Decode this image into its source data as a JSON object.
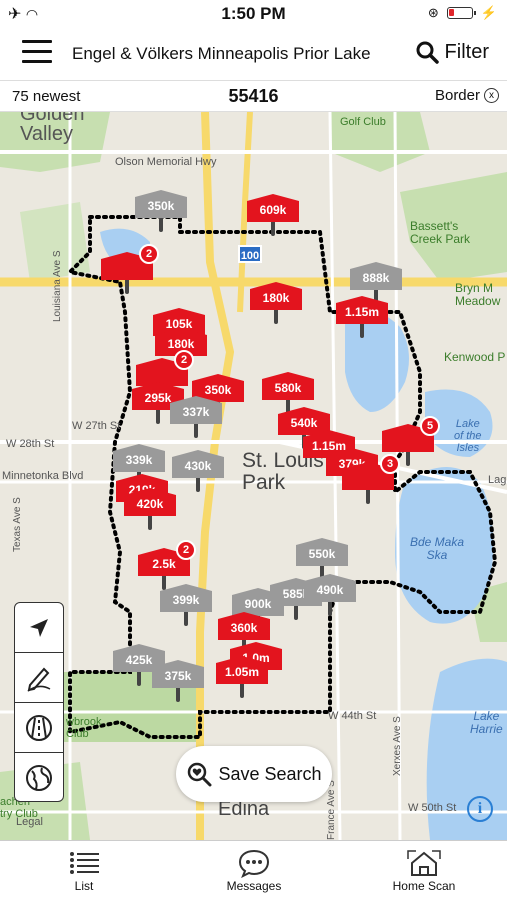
{
  "status_bar": {
    "time": "1:50 PM"
  },
  "header": {
    "title": "Engel & Völkers Minneapolis Prior Lake",
    "filter_label": "Filter"
  },
  "subbar": {
    "newest": "75 newest",
    "zip": "55416",
    "border_label": "Border",
    "border_close": "x"
  },
  "map_labels": {
    "golden_valley": "Golden\nValley",
    "golf_club": "Golf Club",
    "olson": "Olson Memorial Hwy",
    "bassetts": "Bassett's\nCreek Park",
    "bryn_mawr": "Bryn M\nMeadow",
    "kenwood": "Kenwood P",
    "louisiana": "Louisiana Ave S",
    "w27": "W 27th St",
    "w28": "W 28th St",
    "minnetonka": "Minnetonka Blvd",
    "texas": "Texas Ave S",
    "st_louis_park": "St. Louis\nPark",
    "lake_isles": "Lake\nof the\nIsles",
    "bde_maka_ska": "Bde Maka\nSka",
    "lake_harriet": "Lake\nHarrie",
    "w44": "W 44th St",
    "xerxes": "Xerxes Ave S",
    "france": "France Ave S",
    "w50": "W 50th St",
    "edina": "Edina",
    "brook": "wbrook\nClub",
    "country_club": "achen\ntry Club",
    "hwy100": "100",
    "lag": "Lag"
  },
  "pins": [
    {
      "label": "350k",
      "color": "gray",
      "count": ""
    },
    {
      "label": "609k",
      "color": "red",
      "count": ""
    },
    {
      "label": "",
      "color": "red",
      "count": "2"
    },
    {
      "label": "888k",
      "color": "gray",
      "count": ""
    },
    {
      "label": "180k",
      "color": "red",
      "count": ""
    },
    {
      "label": "1.15m",
      "color": "red",
      "count": ""
    },
    {
      "label": "105k",
      "color": "red",
      "count": ""
    },
    {
      "label": "180k",
      "color": "red",
      "count": ""
    },
    {
      "label": "",
      "color": "red",
      "count": "2"
    },
    {
      "label": "295k",
      "color": "red",
      "count": ""
    },
    {
      "label": "350k",
      "color": "red",
      "count": ""
    },
    {
      "label": "337k",
      "color": "gray",
      "count": ""
    },
    {
      "label": "580k",
      "color": "red",
      "count": ""
    },
    {
      "label": "540k",
      "color": "red",
      "count": ""
    },
    {
      "label": "1.15m",
      "color": "red",
      "count": ""
    },
    {
      "label": "379k",
      "color": "red",
      "count": ""
    },
    {
      "label": "",
      "color": "red",
      "count": "5"
    },
    {
      "label": "",
      "color": "red",
      "count": "3"
    },
    {
      "label": "339k",
      "color": "gray",
      "count": ""
    },
    {
      "label": "430k",
      "color": "gray",
      "count": ""
    },
    {
      "label": "219k",
      "color": "red",
      "count": ""
    },
    {
      "label": "420k",
      "color": "red",
      "count": ""
    },
    {
      "label": "2.5k",
      "color": "red",
      "count": "2"
    },
    {
      "label": "550k",
      "color": "gray",
      "count": ""
    },
    {
      "label": "585k",
      "color": "gray",
      "count": ""
    },
    {
      "label": "490k",
      "color": "gray",
      "count": ""
    },
    {
      "label": "399k",
      "color": "gray",
      "count": ""
    },
    {
      "label": "900k",
      "color": "gray",
      "count": ""
    },
    {
      "label": "360k",
      "color": "red",
      "count": ""
    },
    {
      "label": "425k",
      "color": "gray",
      "count": ""
    },
    {
      "label": "375k",
      "color": "gray",
      "count": ""
    },
    {
      "label": "1.0m",
      "color": "red",
      "count": ""
    },
    {
      "label": "1.05m",
      "color": "red",
      "count": ""
    }
  ],
  "save_search": {
    "label": "Save Search"
  },
  "legal": "Legal",
  "tabs": {
    "list": "List",
    "messages": "Messages",
    "home_scan": "Home Scan"
  },
  "colors": {
    "pin_red": "#e3141e",
    "pin_gray": "#9a9a9a",
    "water": "#a9cff2",
    "park": "#bcd9a2",
    "road_major": "#f7d96b"
  }
}
